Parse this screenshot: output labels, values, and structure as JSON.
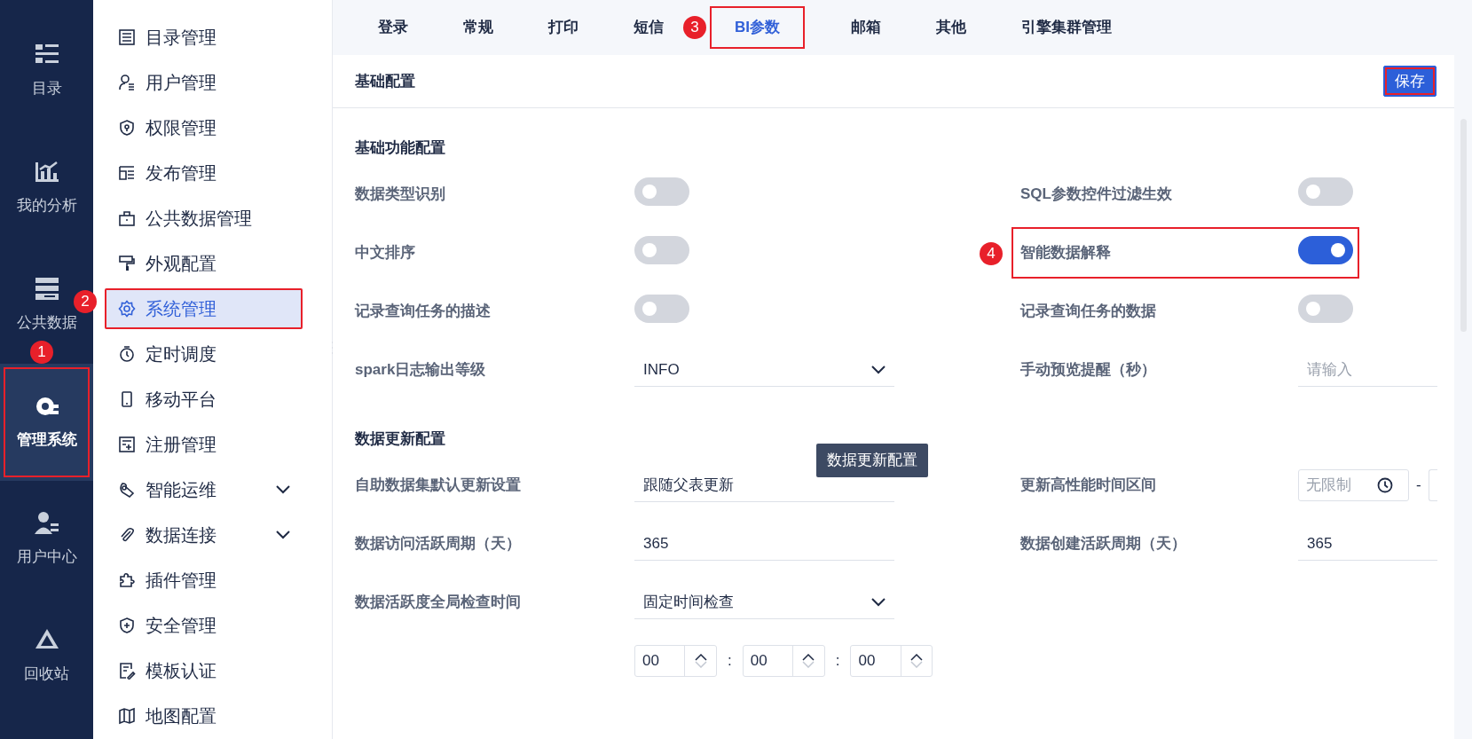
{
  "rail": [
    {
      "label": "目录",
      "selected": false,
      "framed": false
    },
    {
      "label": "我的分析",
      "selected": false,
      "framed": false
    },
    {
      "label": "公共数据",
      "selected": false,
      "framed": false
    },
    {
      "label": "管理系统",
      "selected": true,
      "framed": true,
      "callout_number": "1"
    },
    {
      "label": "用户中心",
      "selected": false,
      "framed": false
    },
    {
      "label": "回收站",
      "selected": false,
      "framed": false
    }
  ],
  "submenu": [
    {
      "label": "目录管理",
      "selected": false,
      "expandable": false,
      "framed": false
    },
    {
      "label": "用户管理",
      "selected": false,
      "expandable": false,
      "framed": false
    },
    {
      "label": "权限管理",
      "selected": false,
      "expandable": false,
      "framed": false
    },
    {
      "label": "发布管理",
      "selected": false,
      "expandable": false,
      "framed": false
    },
    {
      "label": "公共数据管理",
      "selected": false,
      "expandable": false,
      "framed": false
    },
    {
      "label": "外观配置",
      "selected": false,
      "expandable": false,
      "framed": false
    },
    {
      "label": "系统管理",
      "selected": true,
      "expandable": false,
      "framed": true,
      "callout_number": "2"
    },
    {
      "label": "定时调度",
      "selected": false,
      "expandable": false,
      "framed": false
    },
    {
      "label": "移动平台",
      "selected": false,
      "expandable": false,
      "framed": false
    },
    {
      "label": "注册管理",
      "selected": false,
      "expandable": false,
      "framed": false
    },
    {
      "label": "智能运维",
      "selected": false,
      "expandable": true,
      "framed": false
    },
    {
      "label": "数据连接",
      "selected": false,
      "expandable": true,
      "framed": false
    },
    {
      "label": "插件管理",
      "selected": false,
      "expandable": false,
      "framed": false
    },
    {
      "label": "安全管理",
      "selected": false,
      "expandable": false,
      "framed": false
    },
    {
      "label": "模板认证",
      "selected": false,
      "expandable": false,
      "framed": false
    },
    {
      "label": "地图配置",
      "selected": false,
      "expandable": false,
      "framed": false
    }
  ],
  "tabs": [
    {
      "label": "登录",
      "selected": false,
      "framed": false
    },
    {
      "label": "常规",
      "selected": false,
      "framed": false
    },
    {
      "label": "打印",
      "selected": false,
      "framed": false
    },
    {
      "label": "短信",
      "selected": false,
      "framed": false
    },
    {
      "label": "BI参数",
      "selected": true,
      "framed": true,
      "callout_number": "3"
    },
    {
      "label": "邮箱",
      "selected": false,
      "framed": false
    },
    {
      "label": "其他",
      "selected": false,
      "framed": false
    },
    {
      "label": "引擎集群管理",
      "selected": false,
      "framed": false
    }
  ],
  "panel": {
    "title": "基础配置",
    "save_button": {
      "label": "保存",
      "framed": true
    }
  },
  "sections": [
    {
      "title": "基础功能配置",
      "rows": [
        [
          {
            "kind": "switch",
            "label": "数据类型识别",
            "on": false
          },
          {
            "kind": "switch",
            "label": "SQL参数控件过滤生效",
            "on": false
          }
        ],
        [
          {
            "kind": "switch",
            "label": "中文排序",
            "on": false
          },
          {
            "kind": "switch",
            "label": "智能数据解释",
            "on": true,
            "framed": true,
            "callout_number": "4"
          }
        ],
        [
          {
            "kind": "switch",
            "label": "记录查询任务的描述",
            "on": false
          },
          {
            "kind": "switch",
            "label": "记录查询任务的数据",
            "on": false
          }
        ],
        [
          {
            "kind": "select",
            "label": "spark日志输出等级",
            "value": "INFO"
          },
          {
            "kind": "input",
            "label": "手动预览提醒（秒）",
            "placeholder": "请输入"
          }
        ]
      ]
    },
    {
      "title": "数据更新配置",
      "rows": [
        [
          {
            "kind": "select",
            "label": "自助数据集默认更新设置",
            "value": "跟随父表更新",
            "tooltip": "数据更新配置"
          },
          {
            "kind": "time_range",
            "label": "更新高性能时间区间",
            "placeholder": "无限制",
            "separator": "-"
          }
        ],
        [
          {
            "kind": "input",
            "label": "数据访问活跃周期（天）",
            "value": "365"
          },
          {
            "kind": "input",
            "label": "数据创建活跃周期（天）",
            "value": "365"
          }
        ],
        [
          {
            "kind": "select",
            "label": "数据活跃度全局检查时间",
            "value": "固定时间检查"
          }
        ],
        [
          {
            "kind": "time_spinners",
            "values": [
              "00",
              "00",
              "00"
            ],
            "separator": ":"
          }
        ]
      ]
    }
  ]
}
